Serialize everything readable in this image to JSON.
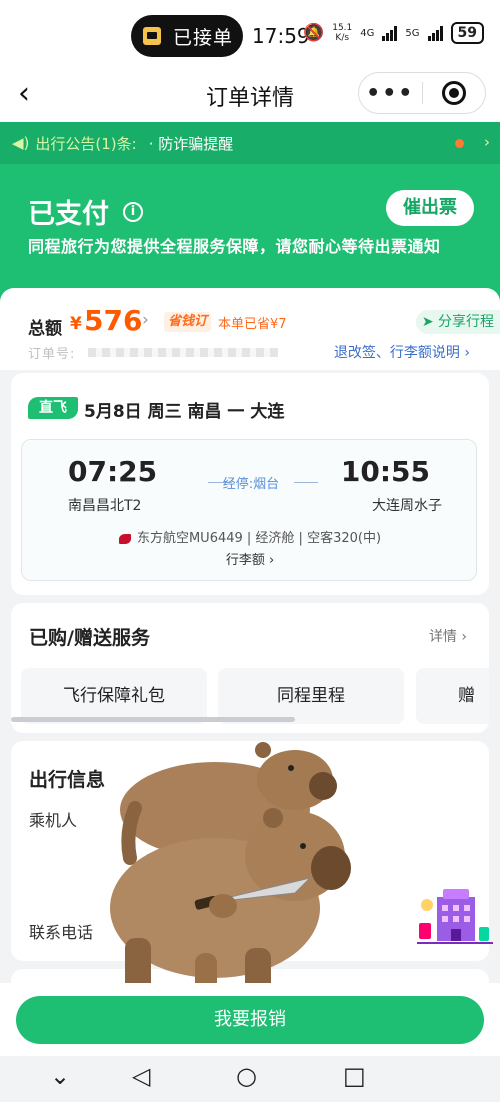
{
  "status_bar": {
    "pill_label": "已接单",
    "time": "17:59",
    "speed_value": "15.1",
    "speed_unit": "K/s",
    "sig1": "4G",
    "sig2": "5G",
    "battery": "59"
  },
  "nav": {
    "back_icon": "chevron-left-icon",
    "title": "订单详情",
    "more_label": "•••"
  },
  "notice": {
    "title": "出行公告(1)条:",
    "text": "· 防诈骗提醒",
    "arrow": "›"
  },
  "status": {
    "title": "已支付",
    "info_icon": "i",
    "urge_button": "催出票",
    "description": "同程旅行为您提供全程服务保障，请您耐心等待出票通知"
  },
  "total": {
    "label": "总额",
    "currency": "¥",
    "amount": "576",
    "chevron": "›",
    "save_tag": "省钱订",
    "saved_text": "本单已省¥7",
    "share_label": "分享行程",
    "order_no_label": "订单号:",
    "refund_link": "退改签、行李额说明 ›"
  },
  "flight": {
    "direct_tag": "直飞",
    "route": "5月8日 周三 南昌 一 大连",
    "dep_time": "07:25",
    "arr_time": "10:55",
    "stop": "经停:烟台",
    "dep_airport": "南昌昌北T2",
    "arr_airport": "大连周水子",
    "airline_info": "东方航空MU6449 | 经济舱 | 空客320(中)",
    "baggage": "行李额 ›"
  },
  "services": {
    "title": "已购/赠送服务",
    "detail_link": "详情 ›",
    "items": [
      "飞行保障礼包",
      "同程里程",
      "赠"
    ]
  },
  "travel_info": {
    "title": "出行信息",
    "passenger_label": "乘机人",
    "phone_label": "联系电话"
  },
  "bottom": {
    "reimburse_button": "我要报销"
  },
  "system_nav": {
    "down": "⌄",
    "back": "◁",
    "home": "○",
    "recent": "□"
  },
  "colors": {
    "brand_green": "#1ebe73",
    "price_orange": "#ff5a00",
    "link_blue": "#3b6ec9"
  }
}
